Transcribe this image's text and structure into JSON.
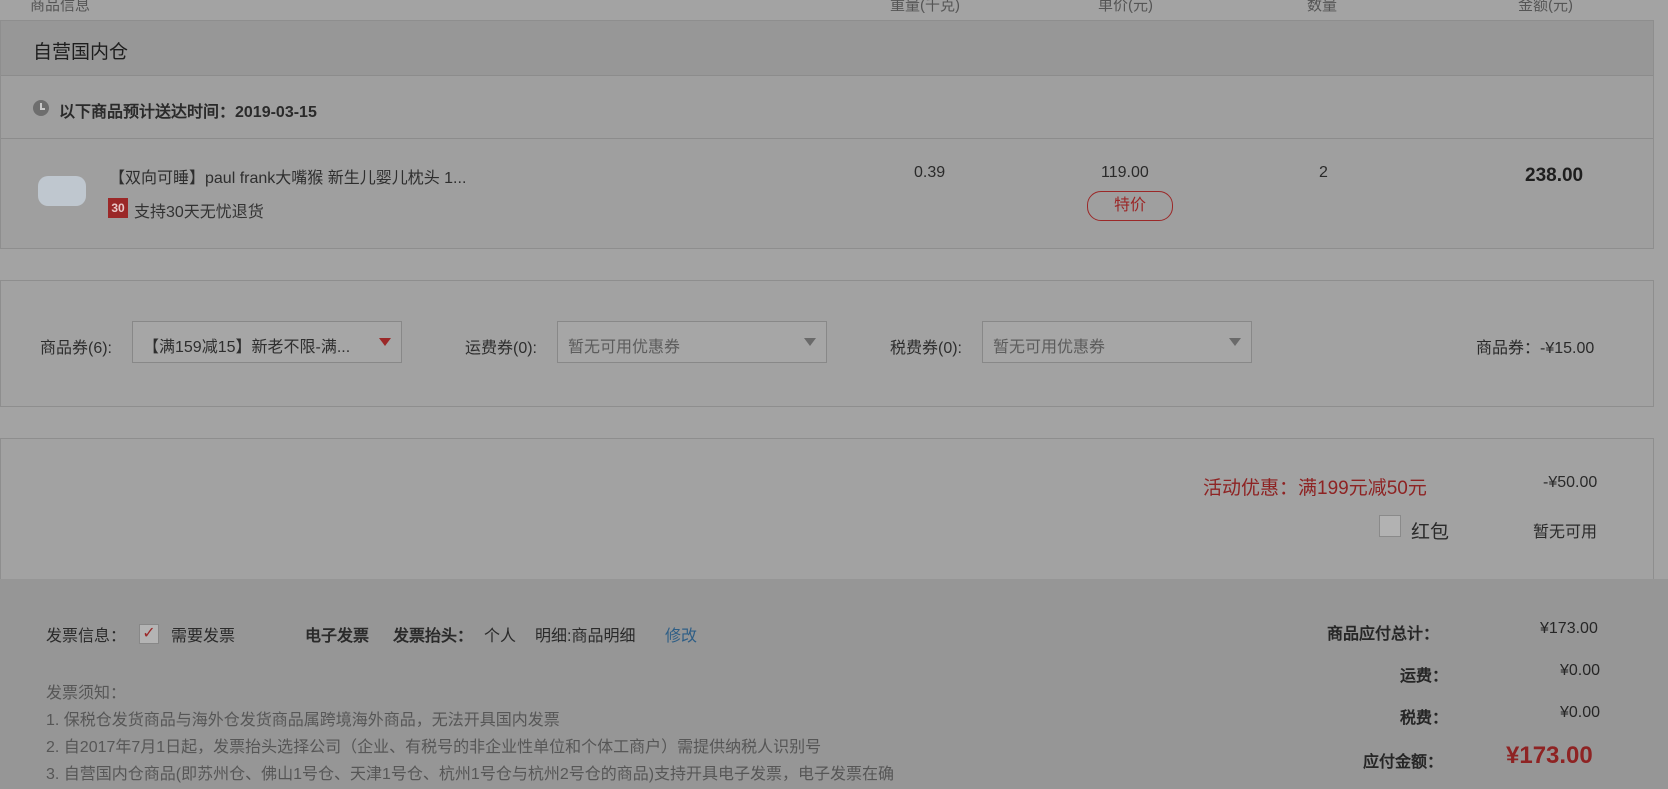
{
  "table_header": {
    "product_info": "商品信息",
    "weight": "重量(千克)",
    "unit_price": "单价(元)",
    "quantity": "数量",
    "amount": "金额(元)"
  },
  "store": {
    "title": "自营国内仓",
    "delivery": "以下商品预计送达时间：2019-03-15"
  },
  "product": {
    "name": "【双向可睡】paul frank大嘴猴 新生儿婴儿枕头 1...",
    "badge": "30",
    "return_policy": "支持30天无忧退货",
    "weight": "0.39",
    "price": "119.00",
    "special_tag": "特价",
    "quantity": "2",
    "amount": "238.00"
  },
  "coupons": {
    "goods_label": "商品券(6):",
    "goods_selected": "【满159减15】新老不限-满...",
    "shipping_label": "运费券(0):",
    "shipping_selected": "暂无可用优惠券",
    "tax_label": "税费券(0):",
    "tax_selected": "暂无可用优惠券",
    "summary": "商品券：-¥15.00"
  },
  "discounts": {
    "promo": "活动优惠：满199元减50元",
    "promo_value": "-¥50.00",
    "hongbao_label": "红包",
    "hongbao_value": "暂无可用"
  },
  "invoice": {
    "label": "发票信息：",
    "check_mark": "✓",
    "need": "需要发票",
    "type": "电子发票",
    "title_label": "发票抬头：",
    "title_value": "个人",
    "detail": "明细:商品明细",
    "edit": "修改",
    "notes_title": "发票须知：",
    "notes": [
      "1. 保税仓发货商品与海外仓发货商品属跨境海外商品，无法开具国内发票",
      "2. 自2017年7月1日起，发票抬头选择公司（企业、有税号的非企业性单位和个体工商户）需提供纳税人识别号",
      "3. 自营国内仓商品(即苏州仓、佛山1号仓、天津1号仓、杭州1号仓与杭州2号仓的商品)支持开具电子发票，电子发票在确"
    ]
  },
  "summary": {
    "goods_total_label": "商品应付总计：",
    "goods_total_value": "¥173.00",
    "shipping_label": "运费：",
    "shipping_value": "¥0.00",
    "tax_label": "税费：",
    "tax_value": "¥0.00",
    "payable_label": "应付金额：",
    "payable_value": "¥173.00"
  },
  "colors": {
    "overlay_bg": "#a3a3a3",
    "accent_red": "#9b2828",
    "link_blue": "#2e5e86"
  }
}
